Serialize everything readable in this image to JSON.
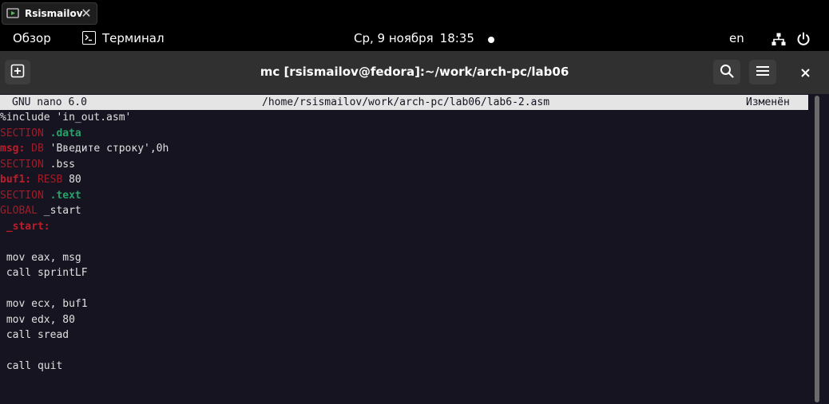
{
  "vm_tab": {
    "label": "Rsismailov",
    "close": "✕"
  },
  "topbar": {
    "activities": "Обзор",
    "app_label": "Терминал",
    "date": "Ср, 9 ноября",
    "time": "18:35",
    "keyboard_layout": "en"
  },
  "terminal": {
    "title": "mc [rsismailov@fedora]:~/work/arch-pc/lab06",
    "close": "✕"
  },
  "nano": {
    "version": "GNU nano 6.0",
    "file_path": "/home/rsismailov/work/arch-pc/lab06/lab6-2.asm",
    "status": "Изменён"
  },
  "code": {
    "l1": "%include 'in_out.asm'",
    "l2_kw": "SECTION",
    "l2_dir": ".data",
    "l3_lbl": "msg:",
    "l3_kw": "DB",
    "l3_rest": "'Введите строку',0h",
    "l4_kw": "SECTION",
    "l4_rest": ".bss",
    "l5_lbl": "buf1:",
    "l5_kw": "RESB",
    "l5_rest": "80",
    "l6_kw": "SECTION",
    "l6_dir": ".text",
    "l7_kw": "GLOBAL",
    "l7_rest": "_start",
    "l8_lbl": "_start:",
    "l10": " mov eax, msg",
    "l11": " call sprintLF",
    "l13": " mov ecx, buf1",
    "l14": " mov edx, 80",
    "l15": " call sread",
    "l17": " call quit"
  }
}
